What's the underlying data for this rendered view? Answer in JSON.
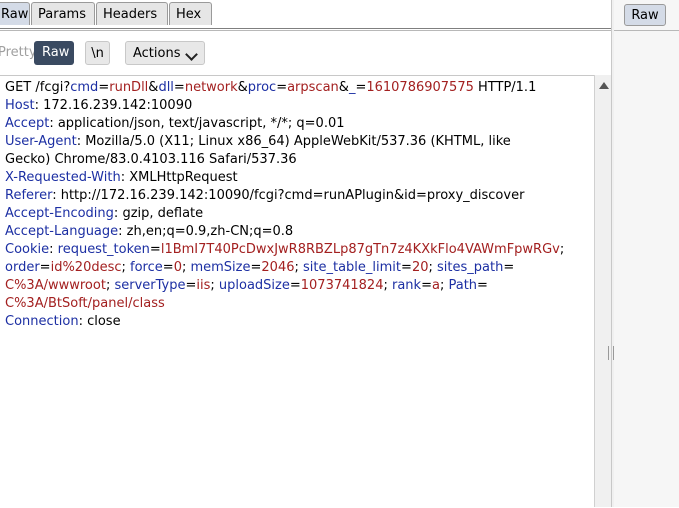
{
  "tabs": [
    {
      "label": "Raw",
      "active": true
    },
    {
      "label": "Params",
      "active": false
    },
    {
      "label": "Headers",
      "active": false
    },
    {
      "label": "Hex",
      "active": false
    }
  ],
  "toolbar": {
    "pretty_label": "Pretty",
    "raw_label": "Raw",
    "newline_label": "\\n",
    "actions_label": "Actions"
  },
  "right_panel": {
    "tab_label": "Raw"
  },
  "request": {
    "line1": {
      "method": "GET ",
      "path": "/fcgi?",
      "params": [
        {
          "name": "cmd",
          "value": "runDll",
          "sep": "&"
        },
        {
          "name": "dll",
          "value": "network",
          "sep": "&"
        },
        {
          "name": "proc",
          "value": "arpscan",
          "sep": "&"
        },
        {
          "name": "_",
          "value": "1610786907575",
          "sep": " "
        }
      ],
      "version": "HTTP/1.1"
    },
    "headers": [
      {
        "name": "Host",
        "value": "172.16.239.142:10090"
      },
      {
        "name": "Accept",
        "value": "application/json, text/javascript, */*; q=0.01"
      },
      {
        "name": "User-Agent",
        "value": "Mozilla/5.0 (X11; Linux x86_64) AppleWebKit/537.36 (KHTML, like"
      },
      {
        "name": "",
        "value": "Gecko) Chrome/83.0.4103.116 Safari/537.36"
      },
      {
        "name": "X-Requested-With",
        "value": "XMLHttpRequest"
      },
      {
        "name": "Referer",
        "value": "http://172.16.239.142:10090/fcgi?cmd=runAPlugin&id=proxy_discover"
      },
      {
        "name": "Accept-Encoding",
        "value": "gzip, deflate"
      },
      {
        "name": "Accept-Language",
        "value": "zh,en;q=0.9,zh-CN;q=0.8"
      }
    ],
    "cookie_label": "Cookie",
    "cookies": [
      {
        "name": "request_token",
        "value": "l1BmI7T40PcDwxJwR8RBZLp87gTn7z4KXkFlo4VAWmFpwRGv"
      },
      {
        "name": "order",
        "value": "id%20desc"
      },
      {
        "name": "force",
        "value": "0"
      },
      {
        "name": "memSize",
        "value": "2046"
      },
      {
        "name": "site_table_limit",
        "value": "20"
      },
      {
        "name": "sites_path",
        "value": "C%3A/wwwroot"
      },
      {
        "name": "serverType",
        "value": "iis"
      },
      {
        "name": "uploadSize",
        "value": "1073741824"
      },
      {
        "name": "rank",
        "value": "a"
      },
      {
        "name": "Path",
        "value": "C%3A/BtSoft/panel/class"
      }
    ],
    "connection": {
      "name": "Connection",
      "value": "close"
    }
  }
}
